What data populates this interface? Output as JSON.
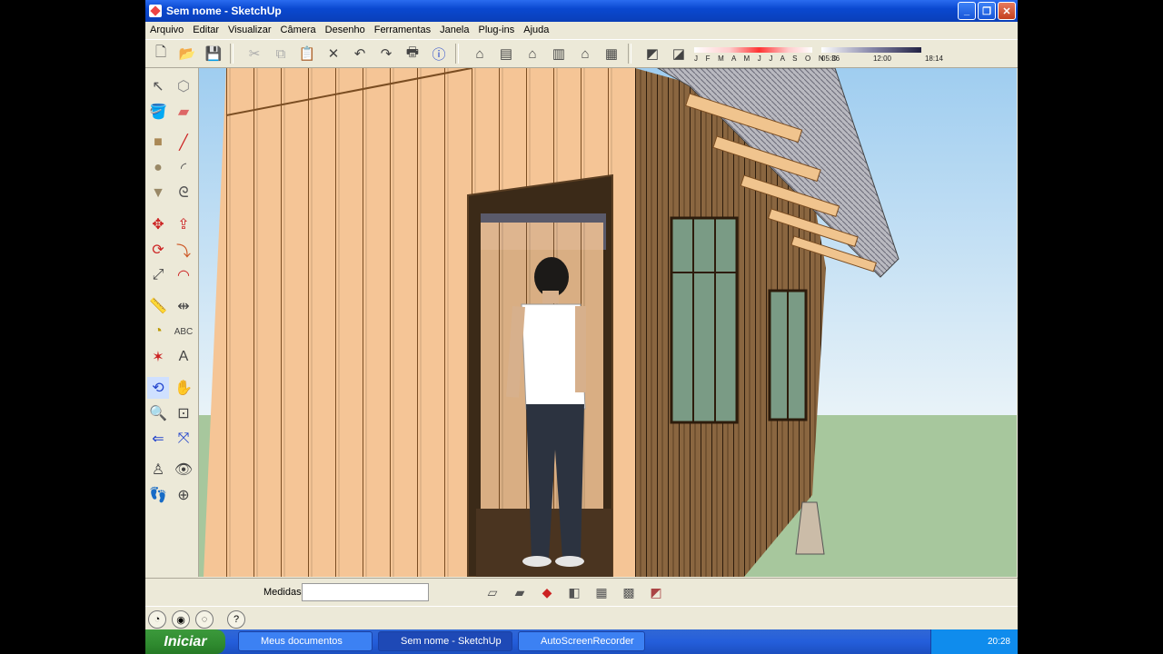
{
  "window": {
    "title": "Sem nome - SketchUp"
  },
  "menu": [
    "Arquivo",
    "Editar",
    "Visualizar",
    "Câmera",
    "Desenho",
    "Ferramentas",
    "Janela",
    "Plug-ins",
    "Ajuda"
  ],
  "shadow_panel": {
    "months": "J F M A M J J A S O N D",
    "time_start": "05:36",
    "time_mid": "12:00",
    "time_end": "18:14"
  },
  "status": {
    "measure_label": "Medidas",
    "measure_value": ""
  },
  "taskbar": {
    "start_label": "Iniciar",
    "tasks": [
      "Meus documentos",
      "Sem nome - SketchUp",
      "AutoScreenRecorder"
    ],
    "clock": "20:28"
  }
}
